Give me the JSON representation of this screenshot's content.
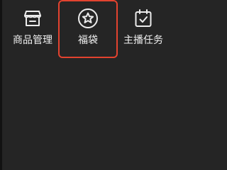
{
  "toolbar": {
    "items": [
      {
        "label": "商品管理",
        "icon": "store-icon",
        "selected": false
      },
      {
        "label": "福袋",
        "icon": "star-badge-icon",
        "selected": true
      },
      {
        "label": "主播任务",
        "icon": "calendar-check-icon",
        "selected": false
      }
    ]
  },
  "colors": {
    "background": "#252525",
    "text": "#f0f0f0",
    "selection_outline": "#e3432f"
  }
}
